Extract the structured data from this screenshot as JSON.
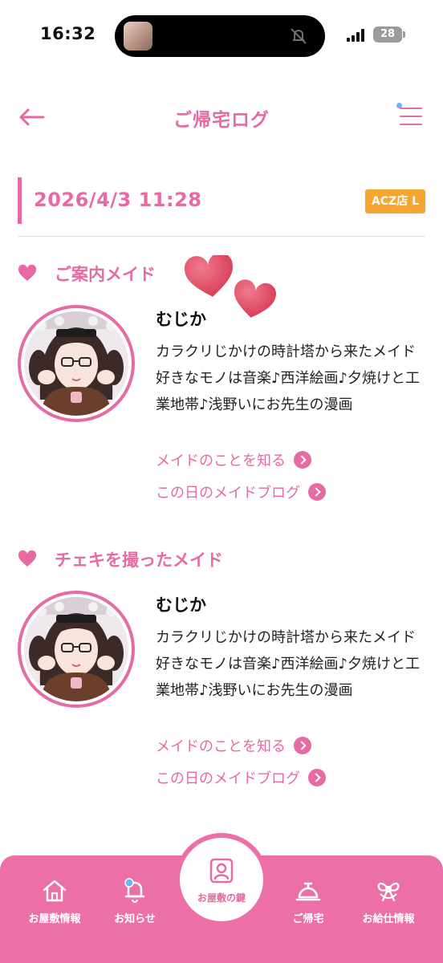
{
  "status_bar": {
    "time": "16:32",
    "battery": "28",
    "island_icon": "silent-bell-slash-icon"
  },
  "header": {
    "title": "ご帰宅ログ",
    "back_icon": "arrow-left-icon",
    "menu_icon": "hamburger-menu-icon"
  },
  "visit": {
    "datetime": "2026/4/3 11:28",
    "store_badge": "ACZ店 L"
  },
  "sections": [
    {
      "heading": "ご案内メイド",
      "maid": {
        "name": "むじか",
        "intro_line1": "カラクリじかけの時計塔から来たメイド",
        "intro_line2": "好きなモノは音楽♪西洋絵画♪夕焼けと工業地帯♪浅野いにお先生の漫画",
        "profile_link": "メイドのことを知る",
        "blog_link": "この日のメイドブログ"
      }
    },
    {
      "heading": "チェキを撮ったメイド",
      "maid": {
        "name": "むじか",
        "intro_line1": "カラクリじかけの時計塔から来たメイド",
        "intro_line2": "好きなモノは音楽♪西洋絵画♪夕焼けと工業地帯♪浅野いにお先生の漫画",
        "profile_link": "メイドのことを知る",
        "blog_link": "この日のメイドブログ"
      }
    }
  ],
  "bottom_nav": {
    "items": [
      {
        "label": "お屋敷情報",
        "icon": "house-icon"
      },
      {
        "label": "お知らせ",
        "icon": "bell-icon"
      },
      {
        "label": "お屋敷の鍵",
        "icon": "member-card-icon"
      },
      {
        "label": "ご帰宅",
        "icon": "service-bell-icon"
      },
      {
        "label": "お給仕情報",
        "icon": "ribbon-icon"
      }
    ]
  },
  "colors": {
    "accent": "#e66aa3",
    "nav_background": "#ec6fa8",
    "badge": "#f6a630",
    "decor_heart": "#e2506a"
  }
}
